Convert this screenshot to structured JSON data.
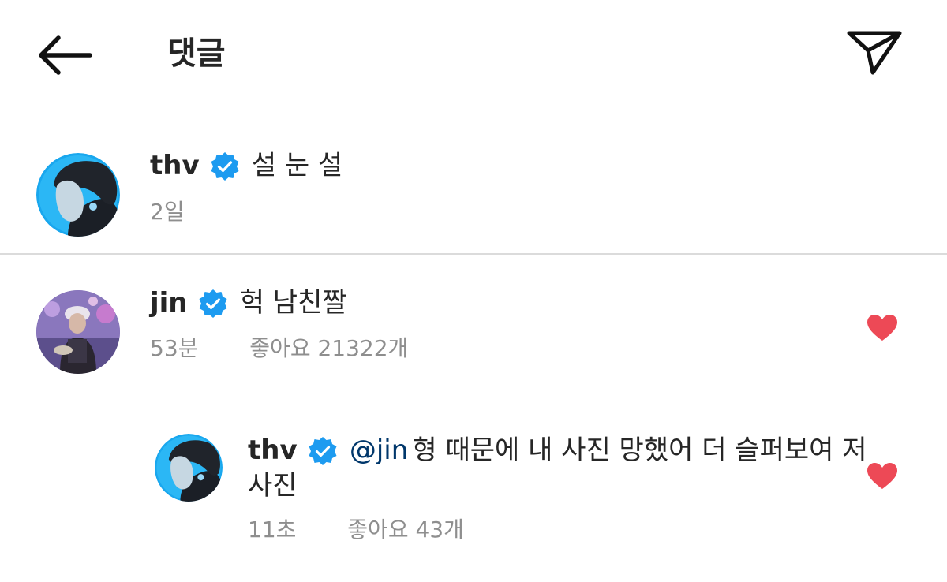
{
  "header": {
    "title": "댓글",
    "back_icon": "arrow-left-icon",
    "share_icon": "send-paper-plane-icon"
  },
  "caption": {
    "username": "thv",
    "verified": true,
    "text": "설 눈 설",
    "time": "2일"
  },
  "comment": {
    "username": "jin",
    "verified": true,
    "text": "헉 남친짤",
    "time": "53분",
    "likes": "좋아요 21322개",
    "liked": true
  },
  "reply": {
    "username": "thv",
    "verified": true,
    "mention": "@jin",
    "text_line1": "형 때문에 내 사진 망했어 더 슬퍼보여 저",
    "text_line2": "사진",
    "time": "11초",
    "likes": "좋아요 43개",
    "liked": true
  },
  "colors": {
    "verified_blue": "#1d9bf0",
    "heart_red": "#ed4956",
    "meta_gray": "#8e8e8e",
    "mention_blue": "#00376b",
    "avatar_ring": "#19a7ee"
  }
}
